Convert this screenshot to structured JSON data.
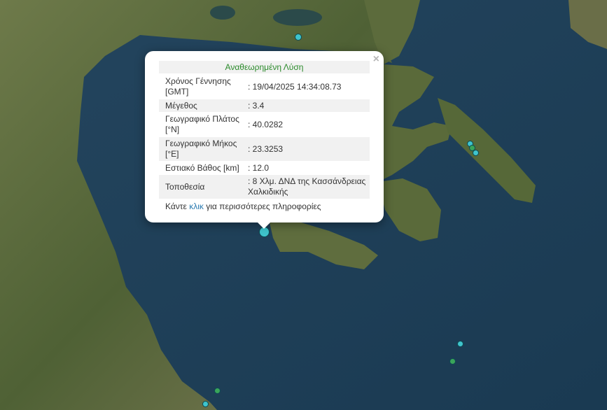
{
  "popup": {
    "title": "Αναθεωρημένη Λύση",
    "close_symbol": "×",
    "rows": [
      {
        "key": "Χρόνος Γέννησης [GMT]",
        "value": ": 19/04/2025 14:34:08.73"
      },
      {
        "key": "Μέγεθος",
        "value": ": 3.4"
      },
      {
        "key": "Γεωγραφικό Πλάτος [°N]",
        "value": ": 40.0282"
      },
      {
        "key": "Γεωγραφικό Μήκος [°E]",
        "value": ": 23.3253"
      },
      {
        "key": "Εστιακό Βάθος [km]",
        "value": ": 12.0"
      },
      {
        "key": "Τοποθεσία",
        "value": ": 8 Χλμ. ΔΝΔ της Κασσάνδρειας Χαλκιδικής"
      }
    ],
    "more_prefix": "Κάντε ",
    "more_link": "κλικ",
    "more_suffix": " για περισσότερες πληροφορίες"
  },
  "colors": {
    "marker_cyan": "#3fc4cc",
    "marker_green": "#3aa55a",
    "sea": "#1f3f57",
    "land": "#5b6a3e"
  }
}
